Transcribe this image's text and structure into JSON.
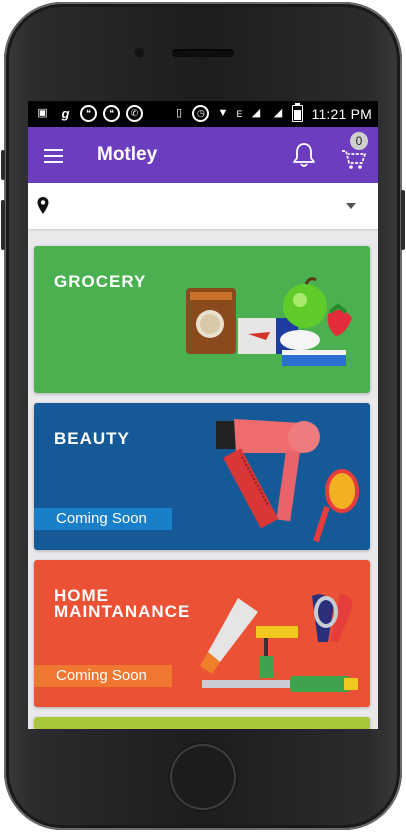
{
  "statusbar": {
    "time": "11:21 PM",
    "left_icons": [
      "sms-icon",
      "g-icon",
      "hangouts-icon",
      "hangouts-icon",
      "whatsapp-icon"
    ],
    "right_icons": [
      "vibrate-icon",
      "alarm-icon",
      "wifi-icon",
      "signal-icon",
      "signal-icon",
      "battery-icon"
    ],
    "network_label": "E"
  },
  "appbar": {
    "title": "Motley",
    "cart_count": "0"
  },
  "location": {
    "value": ""
  },
  "categories": [
    {
      "title": "GROCERY",
      "color": "#4bb050",
      "coming_soon": ""
    },
    {
      "title": "BEAUTY",
      "color": "#155a96",
      "coming_soon": "Coming Soon",
      "badge_color": "#1a7fc9"
    },
    {
      "title_line1": "HOME",
      "title_line2": "MAINTANANCE",
      "color": "#eb5134",
      "coming_soon": "Coming Soon",
      "badge_color": "#f07730"
    },
    {
      "title": "",
      "color": "#a8c83a"
    }
  ]
}
